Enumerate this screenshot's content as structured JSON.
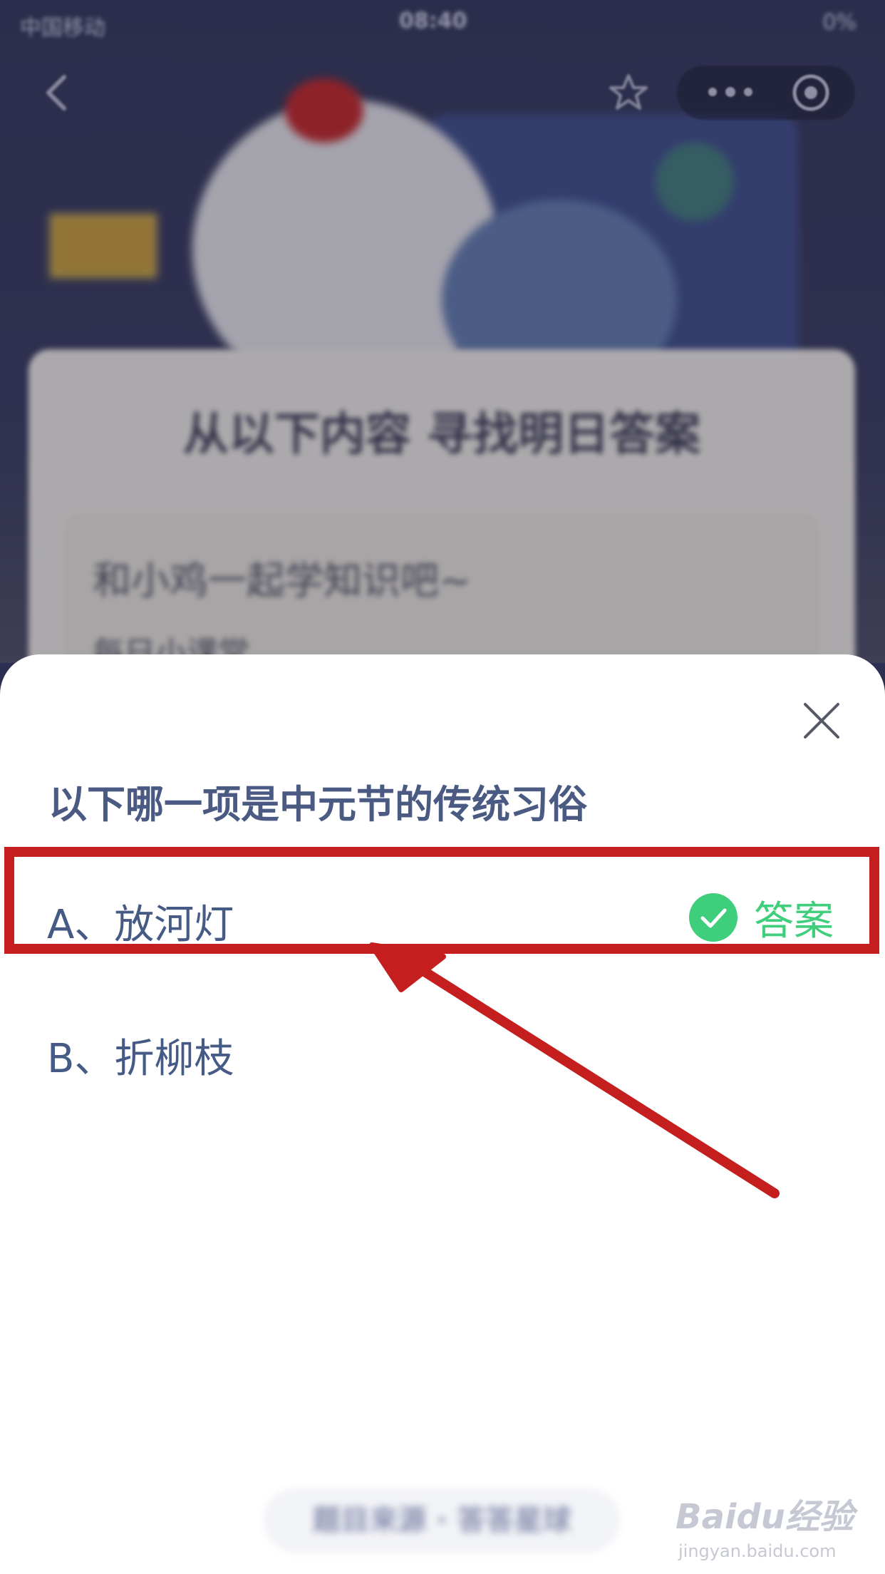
{
  "status_bar": {
    "carrier": "中国移动",
    "time": "08:40",
    "battery": "0%"
  },
  "background": {
    "card_title": "从以下内容 寻找明日答案",
    "inner_title": "和小鸡一起学知识吧~",
    "inner_subtitle": "每日小课堂"
  },
  "quiz": {
    "question": "以下哪一项是中元节的传统习俗",
    "options": [
      {
        "label": "A、放河灯",
        "is_answer": true
      },
      {
        "label": "B、折柳枝",
        "is_answer": false
      }
    ],
    "answer_label": "答案",
    "bottom_button": "题目来源 · 答答星球"
  },
  "watermark": {
    "logo": "Baidu经验",
    "url": "jingyan.baidu.com"
  },
  "colors": {
    "question_text": "#4a5a82",
    "answer_green": "#3fce7b",
    "highlight_red": "#c41e1e",
    "background_navy": "#2f3155"
  },
  "icons": [
    "back-icon",
    "star-icon",
    "more-icon",
    "target-icon",
    "close-icon",
    "check-icon",
    "arrow"
  ]
}
